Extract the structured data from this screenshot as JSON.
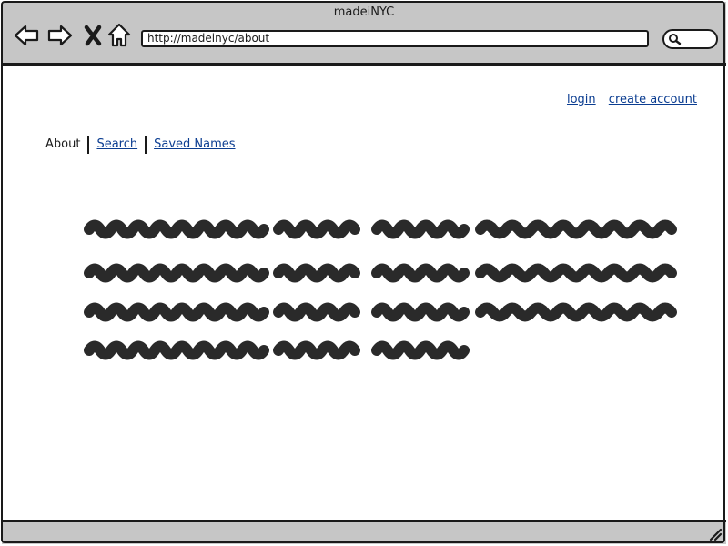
{
  "window": {
    "title": "madeiNYC"
  },
  "toolbar": {
    "back_icon": "arrow-left-icon",
    "forward_icon": "arrow-right-icon",
    "stop_icon": "close-icon",
    "home_icon": "home-icon",
    "search_icon": "search-icon"
  },
  "address_bar": {
    "url": "http://madeinyc/about"
  },
  "account": {
    "login_label": "login",
    "create_account_label": "create account"
  },
  "tabs": {
    "about": "About",
    "search": "Search",
    "saved_names": "Saved Names",
    "active": "About"
  },
  "placeholder_text": {
    "rows": 4,
    "description": "scribbled placeholder text block"
  },
  "colors": {
    "chrome": "#c6c6c6",
    "border": "#1a1a1a",
    "link": "#0b3d91",
    "scribble": "#2a2a2a"
  }
}
